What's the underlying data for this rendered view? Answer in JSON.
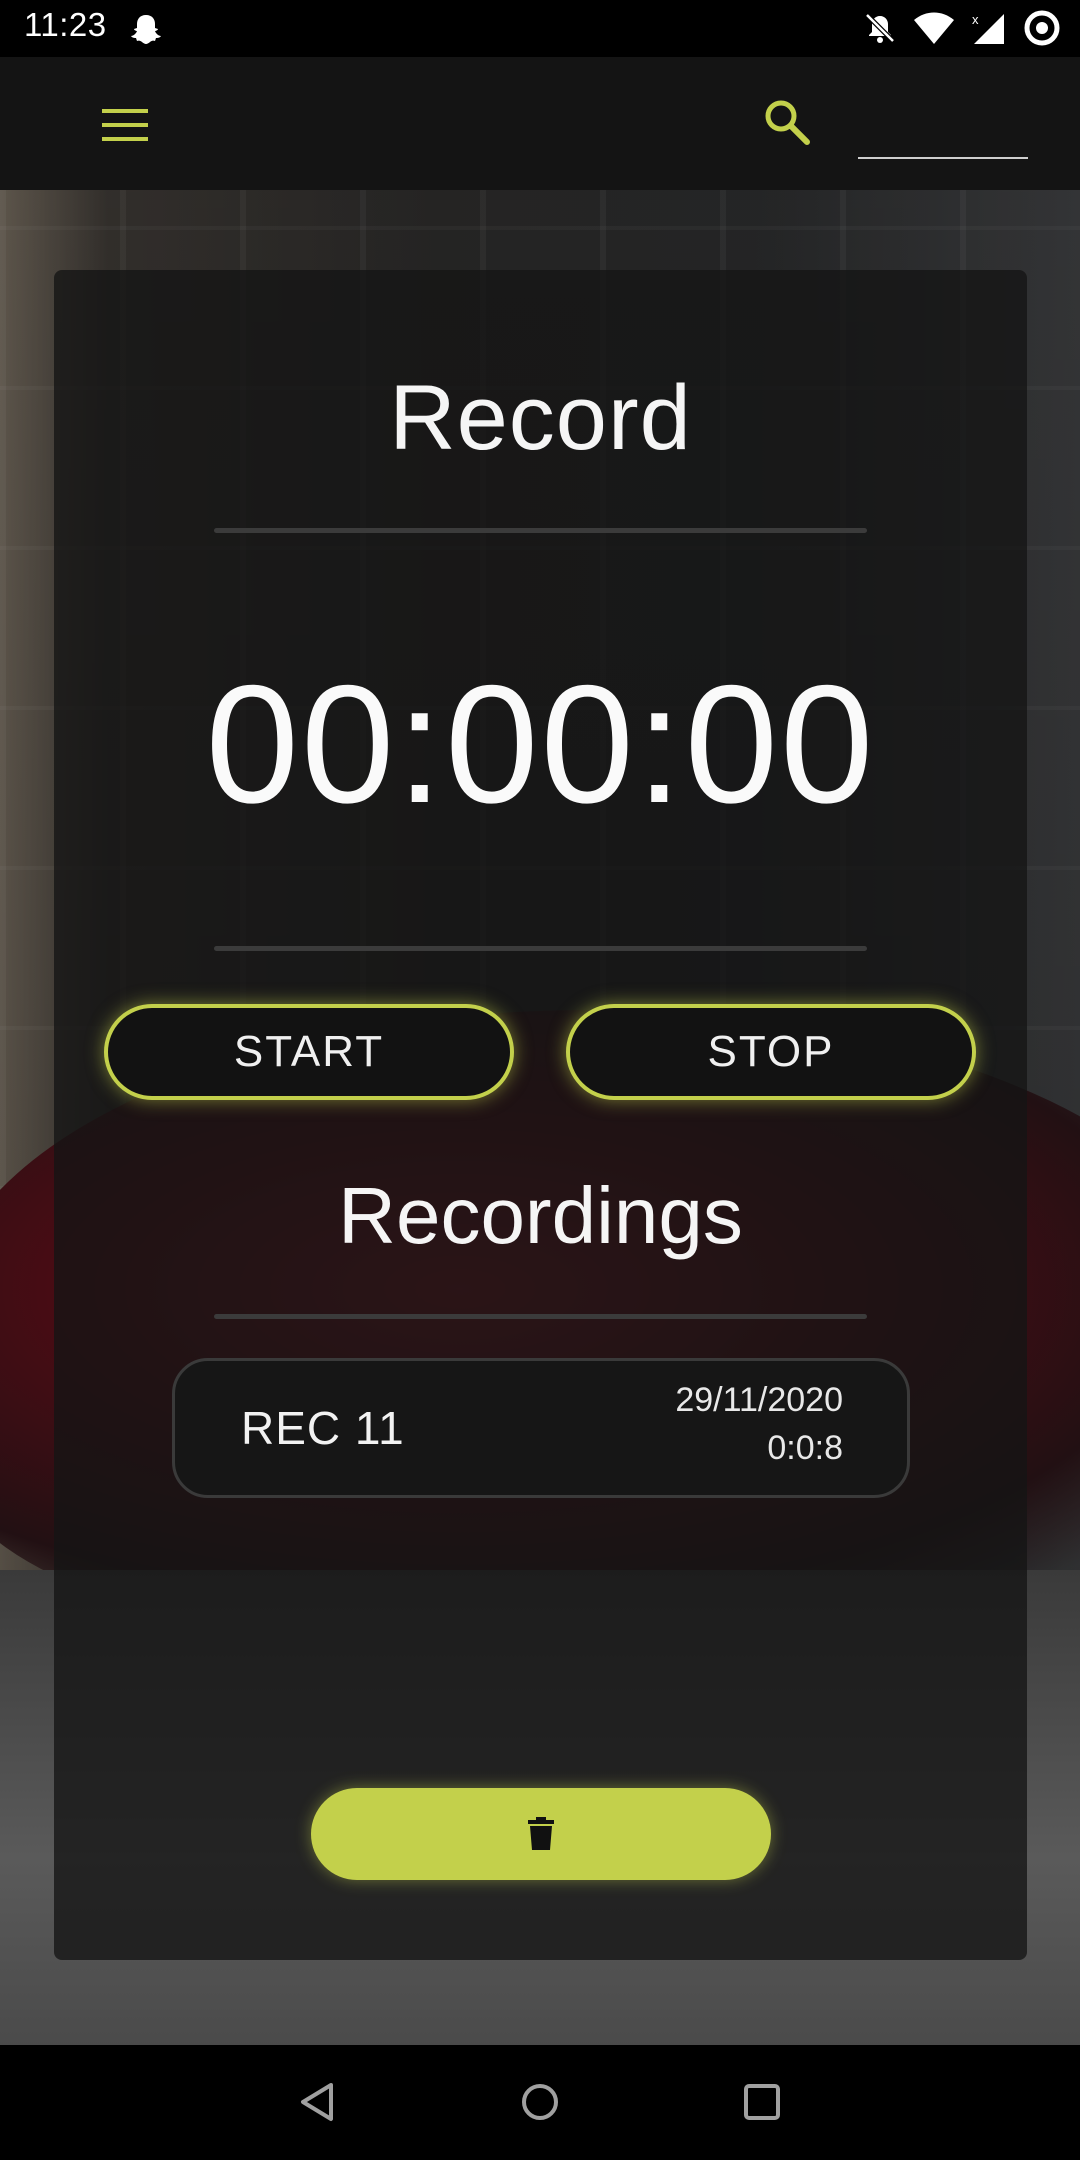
{
  "status_bar": {
    "time": "11:23",
    "icons": [
      "snapchat-ghost-icon",
      "bell-muted-icon",
      "wifi-icon",
      "cell-signal-icon",
      "vpn-ring-icon"
    ]
  },
  "app_bar": {
    "menu_icon": "hamburger-menu-icon",
    "search_icon": "search-icon",
    "search_placeholder": "",
    "accent_color": "#c3d04b"
  },
  "record": {
    "title": "Record",
    "timer": "00:00:00",
    "start_label": "START",
    "stop_label": "STOP"
  },
  "recordings": {
    "title": "Recordings",
    "items": [
      {
        "name": "REC 11",
        "date": "29/11/2020",
        "duration": "0:0:8"
      }
    ],
    "delete_icon": "trash-icon"
  },
  "nav_bar": {
    "back_icon": "back-triangle-icon",
    "home_icon": "home-circle-icon",
    "recents_icon": "recents-square-icon"
  }
}
